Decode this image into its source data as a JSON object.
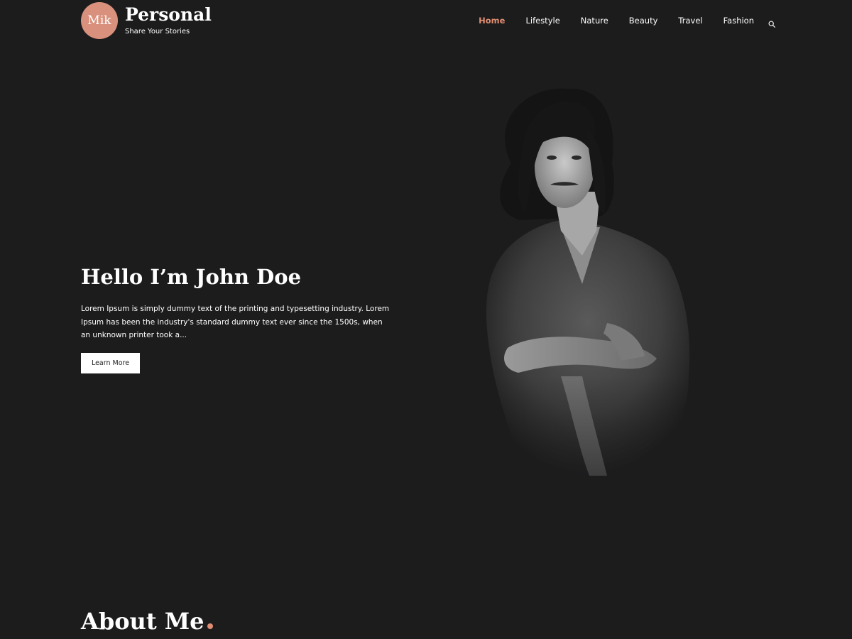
{
  "header": {
    "logo_text": "Mik",
    "site_title": "Personal",
    "tagline": "Share Your Stories"
  },
  "nav": {
    "items": [
      {
        "label": "Home",
        "active": true
      },
      {
        "label": "Lifestyle",
        "active": false
      },
      {
        "label": "Nature",
        "active": false
      },
      {
        "label": "Beauty",
        "active": false
      },
      {
        "label": "Travel",
        "active": false
      },
      {
        "label": "Fashion",
        "active": false
      }
    ],
    "search_icon": "search-icon"
  },
  "hero": {
    "heading": "Hello I’m John Doe",
    "text": "Lorem Ipsum is simply dummy text of the printing and typesetting industry. Lorem Ipsum has been the industry's standard dummy text ever since the 1500s, when an unknown printer took a...",
    "button_label": "Learn More"
  },
  "about": {
    "heading": "About Me"
  },
  "colors": {
    "background": "#1c1c1d",
    "accent": "#e08e72",
    "logo_badge": "#d9907c",
    "text": "#ffffff"
  }
}
